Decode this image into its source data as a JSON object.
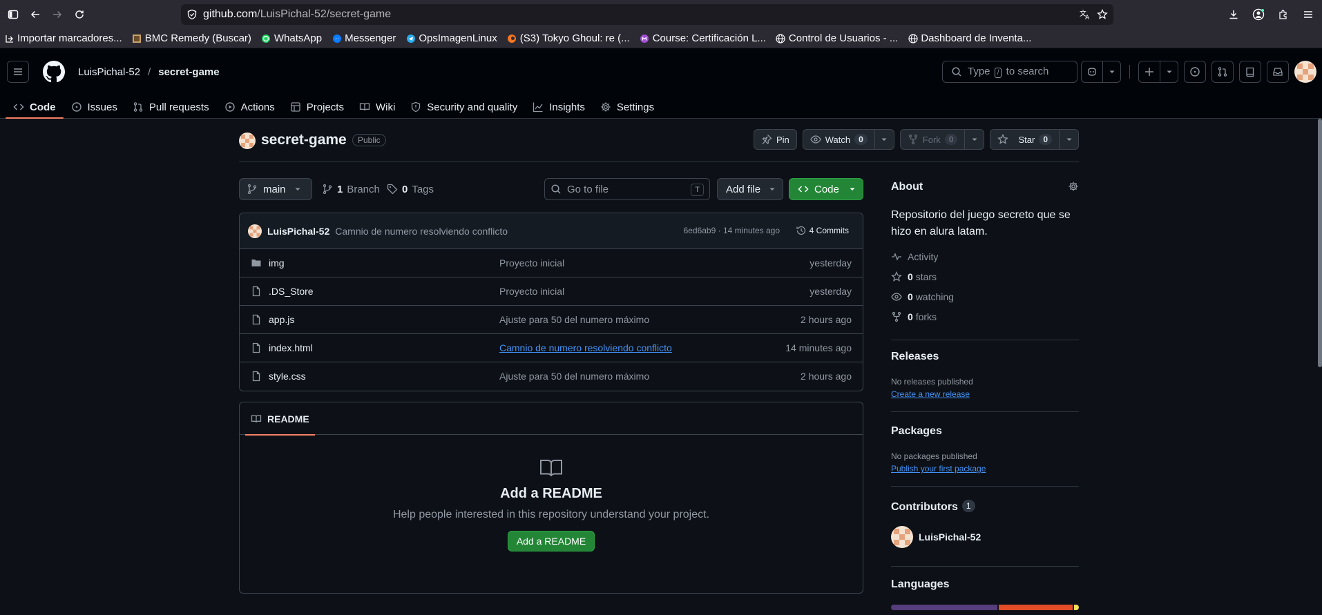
{
  "browser": {
    "url_host": "github.com",
    "url_path": "/LuisPichal-52/secret-game",
    "bookmarks": [
      {
        "label": "Importar marcadores..."
      },
      {
        "label": "BMC Remedy (Buscar)"
      },
      {
        "label": "WhatsApp"
      },
      {
        "label": "Messenger"
      },
      {
        "label": "OpsImagenLinux"
      },
      {
        "label": "(S3) Tokyo Ghoul: re (..."
      },
      {
        "label": "Course: Certificación L..."
      },
      {
        "label": "Control de Usuarios - ..."
      },
      {
        "label": "Dashboard de Inventa..."
      }
    ]
  },
  "header": {
    "owner": "LuisPichal-52",
    "separator": "/",
    "repo": "secret-game",
    "search_before": "Type",
    "search_key": "/",
    "search_after": "to search"
  },
  "nav": {
    "tabs": [
      {
        "label": "Code"
      },
      {
        "label": "Issues"
      },
      {
        "label": "Pull requests"
      },
      {
        "label": "Actions"
      },
      {
        "label": "Projects"
      },
      {
        "label": "Wiki"
      },
      {
        "label": "Security and quality"
      },
      {
        "label": "Insights"
      },
      {
        "label": "Settings"
      }
    ]
  },
  "repo": {
    "name": "secret-game",
    "visibility": "Public",
    "pin_label": "Pin",
    "watch_label": "Watch",
    "watch_count": "0",
    "fork_label": "Fork",
    "fork_count": "0",
    "star_label": "Star",
    "star_count": "0"
  },
  "file_nav": {
    "branch": "main",
    "branch_count": "1",
    "branch_label": "Branch",
    "tag_count": "0",
    "tag_label": "Tags",
    "goto_placeholder": "Go to file",
    "goto_key": "T",
    "add_file_label": "Add file",
    "code_label": "Code"
  },
  "commit": {
    "author": "LuisPichal-52",
    "message": "Camnio de numero resolviendo conflicto",
    "meta": "6ed6ab9 · 14 minutes ago",
    "count_label": "4 Commits"
  },
  "files": [
    {
      "name": "img",
      "type": "folder",
      "message": "Proyecto inicial",
      "age": "yesterday"
    },
    {
      "name": ".DS_Store",
      "type": "file",
      "message": "Proyecto inicial",
      "age": "yesterday"
    },
    {
      "name": "app.js",
      "type": "file",
      "message": "Ajuste para 50 del numero máximo",
      "age": "2 hours ago"
    },
    {
      "name": "index.html",
      "type": "file",
      "message": "Camnio de numero resolviendo conflicto",
      "age": "14 minutes ago"
    },
    {
      "name": "style.css",
      "type": "file",
      "message": "Ajuste para 50 del numero máximo",
      "age": "2 hours ago"
    }
  ],
  "readme": {
    "tab_label": "README",
    "heading": "Add a README",
    "subtext": "Help people interested in this repository understand your project.",
    "button_label": "Add a README"
  },
  "about": {
    "title": "About",
    "description": "Repositorio del juego secreto que se hizo en alura latam.",
    "activity_label": "Activity",
    "stars_count": "0",
    "stars_label": "stars",
    "watching_count": "0",
    "watching_label": "watching",
    "forks_count": "0",
    "forks_label": "forks"
  },
  "releases": {
    "title": "Releases",
    "empty_text": "No releases published",
    "link_label": "Create a new release"
  },
  "packages": {
    "title": "Packages",
    "empty_text": "No packages published",
    "link_label": "Publish your first package"
  },
  "contributors": {
    "title": "Contributors",
    "count": "1",
    "name": "LuisPichal-52"
  },
  "languages": {
    "title": "Languages",
    "segments": [
      {
        "fraction": 0.575,
        "color": "#563d7c"
      },
      {
        "fraction": 0.4,
        "color": "#e34c26"
      },
      {
        "fraction": 0.025,
        "color": "#f1e05a"
      }
    ]
  },
  "colors": {
    "accent_underline": "#f78166",
    "primary_button": "#238636",
    "link": "#4493f8"
  }
}
